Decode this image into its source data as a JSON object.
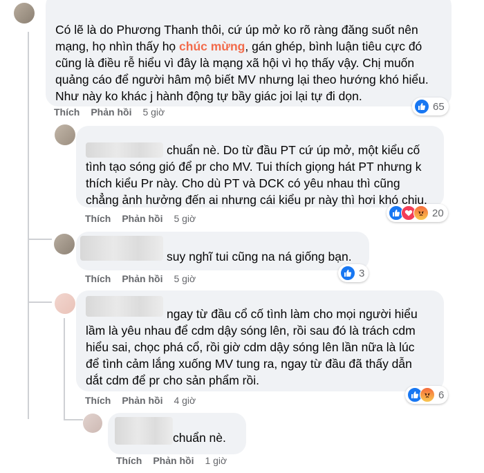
{
  "comments": [
    {
      "lines": [
        "Có lẽ là do Phương Thanh thôi, cứ úp mở ko rõ ràng đăng suốt nên",
        [
          "mạng, họ nhìn thấy họ ",
          "chúc mừng",
          ", gán ghép, bình luận tiêu cực đó"
        ],
        "cũng là điều rễ hiểu vì đây là mạng xã hội vì họ thấy vậy. Chị muốn",
        "quảng cáo để người hâm mộ biết MV nhưng lại theo hướng khó hiểu.",
        "Như này ko khác j hành động tự bầy giác joi lại tự đi dọn."
      ],
      "like_label": "Thích",
      "reply_label": "Phản hồi",
      "time": "5 giờ",
      "reaction_count": "65"
    },
    {
      "lines": [
        "chuẩn nè. Do từ đầu PT cứ úp mở, một kiểu cố",
        "tình tạo sóng gió để pr cho MV. Tui thích giọng hát PT nhưng k",
        "thích kiểu Pr này. Cho dù PT và DCK có yêu nhau thì cũng",
        "chẳng ảnh hưởng đến ai nhưng cái kiểu pr này thì hơi khó chịu."
      ],
      "like_label": "Thích",
      "reply_label": "Phản hồi",
      "time": "5 giờ",
      "reaction_count": "20"
    },
    {
      "lines": [
        "suy nghĩ tui cũng na ná giống bạn."
      ],
      "like_label": "Thích",
      "reply_label": "Phản hồi",
      "time": "5 giờ",
      "reaction_count": "3"
    },
    {
      "lines": [
        "ngay từ đầu cổ cố tình làm cho mọi người hiểu",
        "lầm là yêu nhau để cdm dậy sóng lên, rồi sau đó là trách cdm",
        "hiểu sai, chọc phá cổ, rồi giờ cdm dậy sóng lên lần nữa là lúc",
        "để tình cảm lắng xuống MV tung ra, ngay từ đầu đã thấy dẫn",
        "dắt cdm để pr cho sản phẩm rồi."
      ],
      "like_label": "Thích",
      "reply_label": "Phản hồi",
      "time": "4 giờ",
      "reaction_count": "6"
    },
    {
      "lines": [
        "chuẩn nè."
      ],
      "like_label": "Thích",
      "reply_label": "Phản hồi",
      "time": "1 giờ"
    }
  ],
  "colors": {
    "like": "#1877f2",
    "highlight": "#f26b4b",
    "bubble": "#f0f2f5",
    "meta": "#65676b"
  }
}
